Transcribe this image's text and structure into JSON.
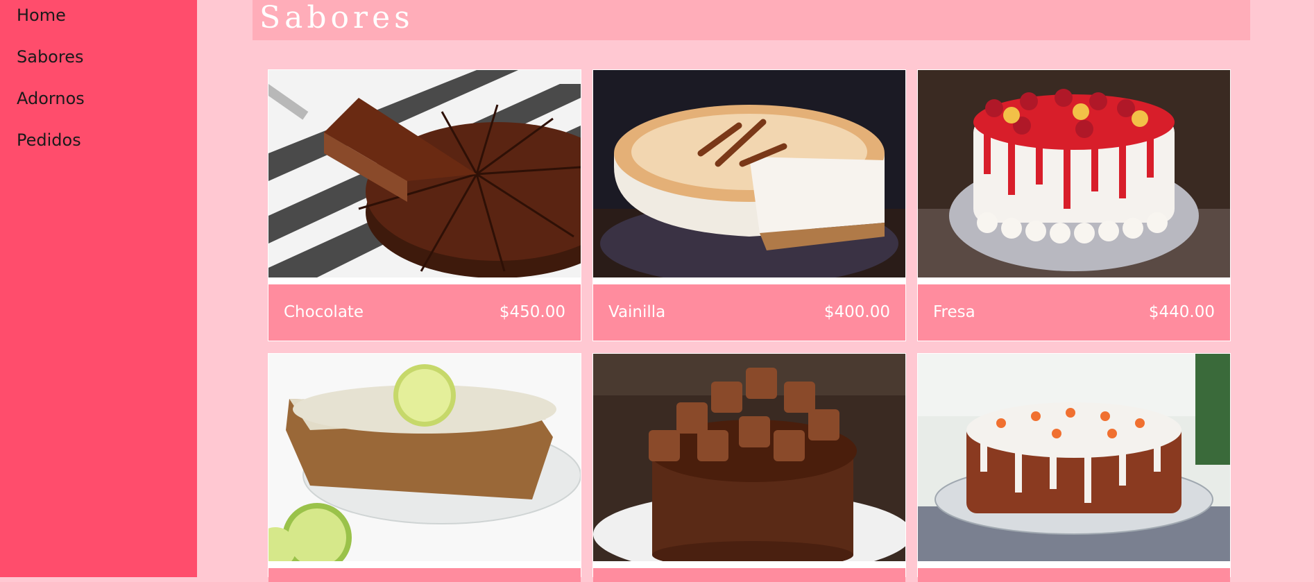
{
  "sidebar": {
    "items": [
      {
        "label": "Home"
      },
      {
        "label": "Sabores"
      },
      {
        "label": "Adornos"
      },
      {
        "label": "Pedidos"
      }
    ]
  },
  "header": {
    "title": "Sabores"
  },
  "products": [
    {
      "name": "Chocolate",
      "price": "$450.00",
      "image": "chocolate-cake-image"
    },
    {
      "name": "Vainilla",
      "price": "$400.00",
      "image": "vanilla-cake-image"
    },
    {
      "name": "Fresa",
      "price": "$440.00",
      "image": "strawberry-cake-image"
    },
    {
      "image": "lemon-cake-image"
    },
    {
      "image": "chocolate-bar-cake-image"
    },
    {
      "image": "carrot-cake-image"
    }
  ],
  "colors": {
    "sidebar": "#ff4d6c",
    "background": "#ffc8d2",
    "header": "#ffadb9",
    "card_bar": "#ff8c9e"
  }
}
